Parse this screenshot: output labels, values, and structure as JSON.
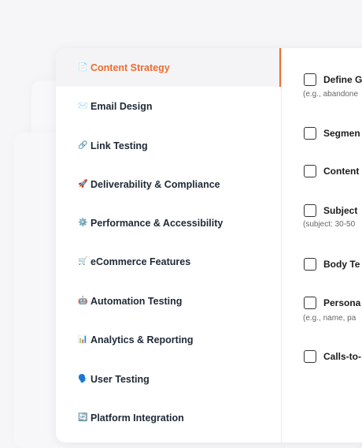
{
  "sidebar": {
    "items": [
      {
        "icon": "📄",
        "label": "Content Strategy",
        "active": true
      },
      {
        "icon": "✉️",
        "label": "Email Design"
      },
      {
        "icon": "🔗",
        "label": "Link Testing"
      },
      {
        "icon": "🚀",
        "label": "Deliverability & Compliance"
      },
      {
        "icon": "⚙️",
        "label": "Performance & Accessibility"
      },
      {
        "icon": "🛒",
        "label": "eCommerce Features"
      },
      {
        "icon": "🤖",
        "label": "Automation Testing"
      },
      {
        "icon": "📊",
        "label": "Analytics & Reporting"
      },
      {
        "icon": "🗣️",
        "label": "User Testing"
      },
      {
        "icon": "🔄",
        "label": "Platform Integration"
      }
    ]
  },
  "checklist": {
    "items": [
      {
        "label": "Define G",
        "hint": "(e.g., abandone"
      },
      {
        "label": "Segmen"
      },
      {
        "label": "Content"
      },
      {
        "label": "Subject",
        "hint": "(subject: 30-50"
      },
      {
        "label": "Body Te"
      },
      {
        "label": "Persona",
        "hint": "(e.g., name, pa"
      },
      {
        "label": "Calls-to-"
      }
    ]
  },
  "colors": {
    "accent": "#ef6c2f"
  }
}
